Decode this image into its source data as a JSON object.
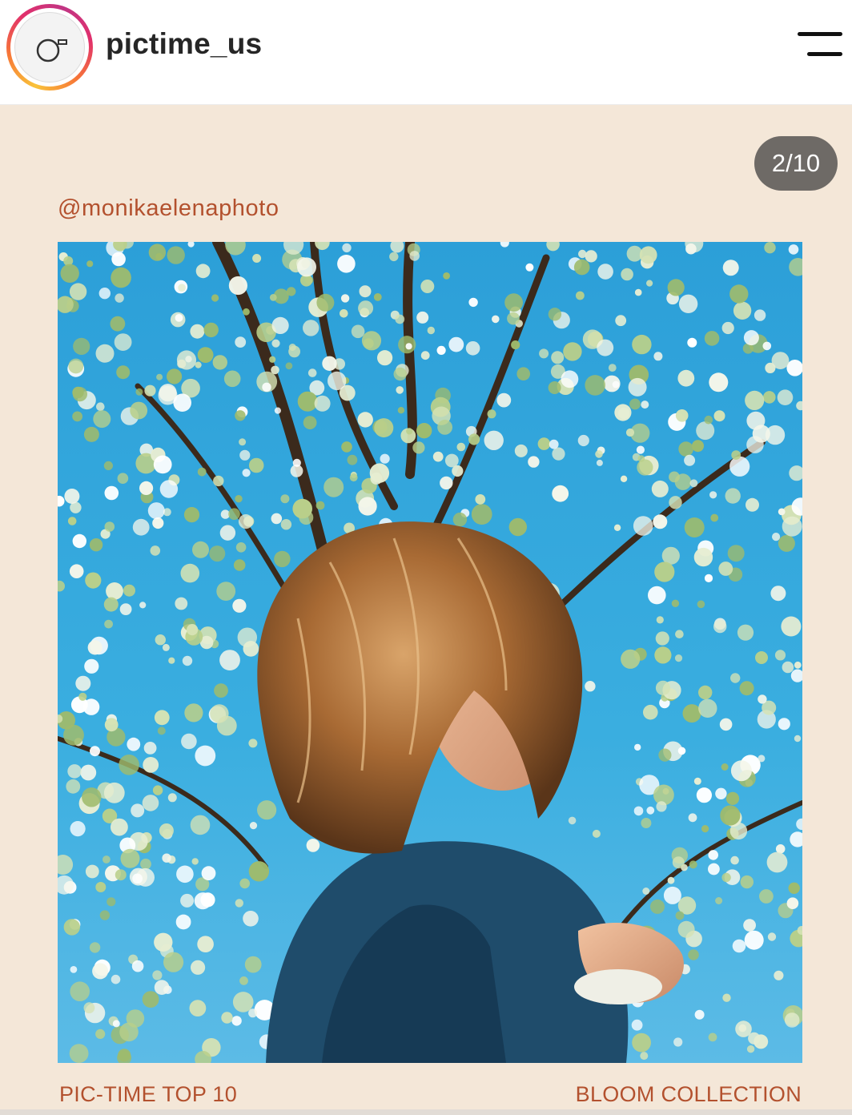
{
  "header": {
    "username": "pictime_us",
    "avatar_icon": "camera-logo-icon",
    "menu_icon": "hamburger-menu-icon"
  },
  "post": {
    "counter": "2/10",
    "handle": "@monikaelenaphoto",
    "footer_left": "PIC-TIME TOP 10",
    "footer_right": "BLOOM COLLECTION"
  },
  "colors": {
    "post_background": "#f4e7d8",
    "accent_text": "#b3512e",
    "counter_background": "#6e6a66",
    "ring_gradient": [
      "#f9c33a",
      "#f77737",
      "#e1306c",
      "#c13584"
    ]
  }
}
